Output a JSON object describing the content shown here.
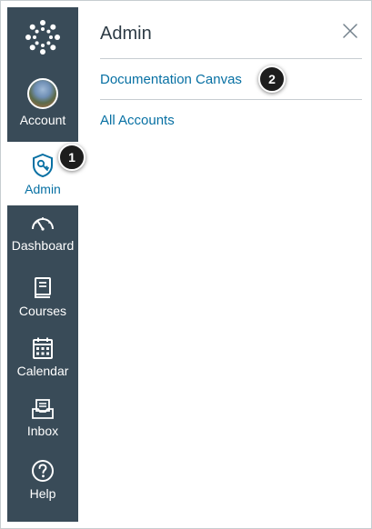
{
  "nav": {
    "logo_icon": "canvas-logo-icon",
    "items": [
      {
        "label": "Account",
        "icon": "avatar"
      },
      {
        "label": "Admin",
        "icon": "admin-shield-icon",
        "active": true
      },
      {
        "label": "Dashboard",
        "icon": "dashboard-icon"
      },
      {
        "label": "Courses",
        "icon": "courses-icon"
      },
      {
        "label": "Calendar",
        "icon": "calendar-icon"
      },
      {
        "label": "Inbox",
        "icon": "inbox-icon"
      },
      {
        "label": "Help",
        "icon": "help-icon"
      }
    ]
  },
  "tray": {
    "title": "Admin",
    "close_icon": "close-icon",
    "links": [
      "Documentation Canvas",
      "All Accounts"
    ]
  },
  "callouts": [
    "1",
    "2"
  ],
  "colors": {
    "nav_background": "#394b58",
    "link": "#0770a3",
    "active_nav_text": "#0770a3",
    "callout_background": "#1d1d1d"
  }
}
